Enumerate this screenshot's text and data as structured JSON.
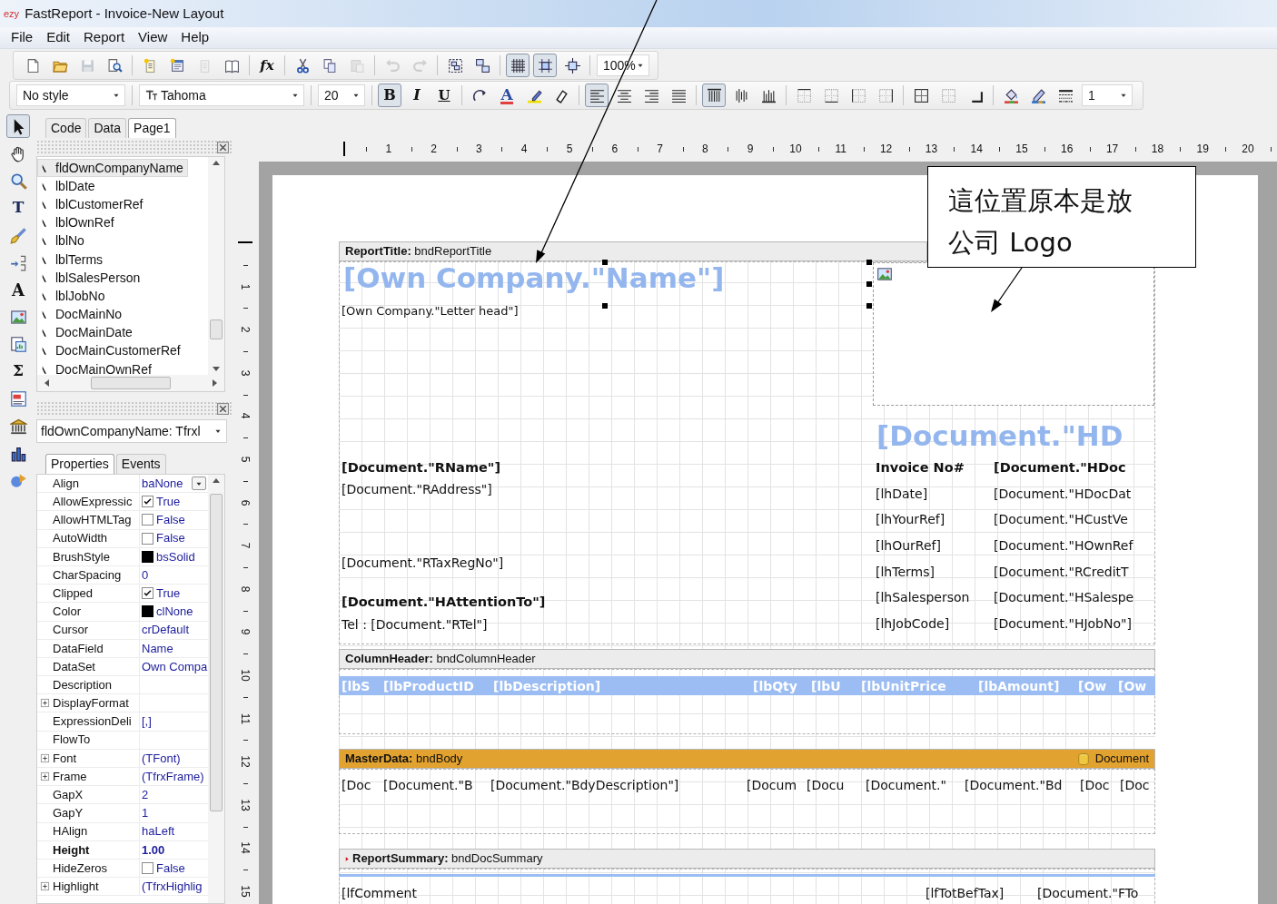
{
  "window": {
    "app_badge": "ezy",
    "title": "FastReport - Invoice-New Layout"
  },
  "menu": [
    "File",
    "Edit",
    "Report",
    "View",
    "Help"
  ],
  "toolbar_standard": [
    [
      {
        "kind": "new",
        "selected": false,
        "disabled": false
      },
      {
        "kind": "open",
        "selected": false,
        "disabled": false
      },
      {
        "kind": "save",
        "selected": false,
        "disabled": true
      },
      {
        "kind": "preview",
        "selected": false,
        "disabled": false
      }
    ],
    [
      {
        "kind": "addpage",
        "selected": false,
        "disabled": false
      },
      {
        "kind": "adddialog",
        "selected": false,
        "disabled": false
      },
      {
        "kind": "delpage",
        "selected": false,
        "disabled": true
      },
      {
        "kind": "pagesettings",
        "selected": false,
        "disabled": false
      }
    ],
    [
      {
        "kind": "formula",
        "label": "fx",
        "selected": false,
        "disabled": false
      }
    ],
    [
      {
        "kind": "cut",
        "selected": false,
        "disabled": false
      },
      {
        "kind": "copy",
        "selected": false,
        "disabled": false
      },
      {
        "kind": "paste",
        "selected": false,
        "disabled": true
      }
    ],
    [
      {
        "kind": "undo",
        "selected": false,
        "disabled": true
      },
      {
        "kind": "redo",
        "selected": false,
        "disabled": true
      }
    ],
    [
      {
        "kind": "group",
        "selected": false,
        "disabled": false
      },
      {
        "kind": "ungroup",
        "selected": false,
        "disabled": false
      }
    ],
    [
      {
        "kind": "grid",
        "selected": true,
        "disabled": false
      },
      {
        "kind": "snap",
        "selected": true,
        "disabled": false
      },
      {
        "kind": "fit",
        "selected": false,
        "disabled": false
      }
    ],
    [
      {
        "kind": "combo",
        "value": "100%"
      }
    ]
  ],
  "toolbar_format": [
    [
      {
        "kind": "combo",
        "value": "No style"
      }
    ],
    [
      {
        "kind": "font_combo",
        "value": "Tahoma"
      }
    ],
    [
      {
        "kind": "combo",
        "value": "20"
      }
    ],
    [
      {
        "kind": "bold",
        "label": "B",
        "selected": true,
        "disabled": false
      },
      {
        "kind": "italic",
        "label": "I",
        "selected": false,
        "disabled": false
      },
      {
        "kind": "underline",
        "label": "U",
        "selected": false,
        "disabled": false
      }
    ],
    [
      {
        "kind": "rotate",
        "selected": false,
        "disabled": false
      },
      {
        "kind": "fontcolor",
        "label": "A",
        "selected": false,
        "disabled": false
      },
      {
        "kind": "highlight",
        "selected": false,
        "disabled": false
      },
      {
        "kind": "clearfmt",
        "selected": false,
        "disabled": false
      }
    ],
    [
      {
        "kind": "alignleft",
        "selected": true,
        "disabled": false
      },
      {
        "kind": "aligncenter",
        "selected": false,
        "disabled": false
      },
      {
        "kind": "alignright",
        "selected": false,
        "disabled": false
      },
      {
        "kind": "justify",
        "selected": false,
        "disabled": false
      }
    ],
    [
      {
        "kind": "vtop",
        "selected": true,
        "disabled": false
      },
      {
        "kind": "vmid",
        "selected": false,
        "disabled": false
      },
      {
        "kind": "vbottom",
        "selected": false,
        "disabled": false
      }
    ],
    [
      {
        "kind": "frametop",
        "selected": false,
        "disabled": false
      },
      {
        "kind": "framebottom",
        "selected": false,
        "disabled": false
      },
      {
        "kind": "frameleft",
        "selected": false,
        "disabled": false
      },
      {
        "kind": "frameright",
        "selected": false,
        "disabled": false
      }
    ],
    [
      {
        "kind": "frameall",
        "selected": false,
        "disabled": false
      },
      {
        "kind": "framenone",
        "selected": false,
        "disabled": false
      },
      {
        "kind": "shadow",
        "selected": false,
        "disabled": false
      }
    ],
    [
      {
        "kind": "fill",
        "selected": false,
        "disabled": false
      },
      {
        "kind": "framecolor",
        "selected": false,
        "disabled": false
      },
      {
        "kind": "linestyle",
        "selected": false,
        "disabled": false
      },
      {
        "kind": "combo",
        "value": "1"
      }
    ]
  ],
  "toolbox": [
    {
      "kind": "select",
      "selected": true
    },
    {
      "kind": "hand",
      "selected": false
    },
    {
      "kind": "zoom",
      "selected": false
    },
    {
      "kind": "textedit",
      "label": "T",
      "selected": false
    },
    {
      "kind": "brush",
      "selected": false
    },
    {
      "kind": "connector",
      "selected": false
    },
    {
      "kind": "textobj",
      "label": "A",
      "selected": false
    },
    {
      "kind": "picture",
      "selected": false
    },
    {
      "kind": "subreport",
      "selected": false
    },
    {
      "kind": "sum",
      "label": "Σ",
      "selected": false
    },
    {
      "kind": "richtext",
      "selected": false
    },
    {
      "kind": "building",
      "selected": false
    },
    {
      "kind": "chart",
      "selected": false
    },
    {
      "kind": "shapes",
      "selected": false
    }
  ],
  "page_tabs": [
    {
      "label": "Code",
      "selected": false
    },
    {
      "label": "Data",
      "selected": false
    },
    {
      "label": "Page1",
      "selected": true
    }
  ],
  "object_tree": [
    {
      "label": "fldOwnCompanyName",
      "selected": true
    },
    {
      "label": "lblDate",
      "selected": false
    },
    {
      "label": "lblCustomerRef",
      "selected": false
    },
    {
      "label": "lblOwnRef",
      "selected": false
    },
    {
      "label": "lblNo",
      "selected": false
    },
    {
      "label": "lblTerms",
      "selected": false
    },
    {
      "label": "lblSalesPerson",
      "selected": false
    },
    {
      "label": "lblJobNo",
      "selected": false
    },
    {
      "label": "DocMainNo",
      "selected": false
    },
    {
      "label": "DocMainDate",
      "selected": false
    },
    {
      "label": "DocMainCustomerRef",
      "selected": false
    },
    {
      "label": "DocMainOwnRef",
      "selected": false
    }
  ],
  "object_selector": "fldOwnCompanyName: Tfrxl",
  "inspector_tabs": [
    {
      "label": "Properties",
      "selected": true
    },
    {
      "label": "Events",
      "selected": false
    }
  ],
  "properties": [
    {
      "name": "Align",
      "value": "baNone",
      "kind": "dropdown",
      "expandable": false,
      "modified": false
    },
    {
      "name": "AllowExpressic",
      "value": "True",
      "kind": "check",
      "checked": true,
      "expandable": false,
      "modified": false
    },
    {
      "name": "AllowHTMLTag",
      "value": "False",
      "kind": "check",
      "checked": false,
      "expandable": false,
      "modified": false
    },
    {
      "name": "AutoWidth",
      "value": "False",
      "kind": "check",
      "checked": false,
      "expandable": false,
      "modified": false
    },
    {
      "name": "BrushStyle",
      "value": "bsSolid",
      "kind": "swatch",
      "expandable": false,
      "modified": false
    },
    {
      "name": "CharSpacing",
      "value": "0",
      "kind": "text",
      "expandable": false,
      "modified": false
    },
    {
      "name": "Clipped",
      "value": "True",
      "kind": "check",
      "checked": true,
      "expandable": false,
      "modified": false
    },
    {
      "name": "Color",
      "value": "clNone",
      "kind": "swatch",
      "expandable": false,
      "modified": false
    },
    {
      "name": "Cursor",
      "value": "crDefault",
      "kind": "text",
      "expandable": false,
      "modified": false
    },
    {
      "name": "DataField",
      "value": "Name",
      "kind": "text",
      "expandable": false,
      "modified": false
    },
    {
      "name": "DataSet",
      "value": "Own Compa",
      "kind": "text",
      "expandable": false,
      "modified": false
    },
    {
      "name": "Description",
      "kind": "text",
      "expandable": false,
      "modified": false
    },
    {
      "name": "DisplayFormat",
      "kind": "text",
      "expandable": true,
      "modified": false
    },
    {
      "name": "ExpressionDeli",
      "value": "[,]",
      "kind": "text",
      "expandable": false,
      "modified": false
    },
    {
      "name": "FlowTo",
      "kind": "text",
      "expandable": false,
      "modified": false
    },
    {
      "name": "Font",
      "value": "(TFont)",
      "kind": "text",
      "expandable": true,
      "modified": false
    },
    {
      "name": "Frame",
      "value": "(TfrxFrame)",
      "kind": "text",
      "expandable": true,
      "modified": false
    },
    {
      "name": "GapX",
      "value": "2",
      "kind": "text",
      "expandable": false,
      "modified": false
    },
    {
      "name": "GapY",
      "value": "1",
      "kind": "text",
      "expandable": false,
      "modified": false
    },
    {
      "name": "HAlign",
      "value": "haLeft",
      "kind": "text",
      "expandable": false,
      "modified": false
    },
    {
      "name": "Height",
      "value": "1.00",
      "kind": "text",
      "expandable": false,
      "modified": true
    },
    {
      "name": "HideZeros",
      "value": "False",
      "kind": "check",
      "checked": false,
      "expandable": false,
      "modified": false
    },
    {
      "name": "Highlight",
      "value": "(TfrxHighlig",
      "kind": "text",
      "expandable": true,
      "modified": false
    }
  ],
  "ruler": {
    "horizontal": [
      "1",
      "2",
      "3",
      "4",
      "5",
      "6",
      "7",
      "8",
      "9",
      "10",
      "11",
      "12",
      "13",
      "14",
      "15",
      "16",
      "17",
      "18",
      "19",
      "20"
    ],
    "vertical": [
      "1",
      "2",
      "3",
      "4",
      "5",
      "6",
      "7",
      "8",
      "9",
      "10",
      "11",
      "12",
      "13",
      "14",
      "15"
    ]
  },
  "report": {
    "title_band": {
      "caption": "**ReportTitle:** bndReportTitle",
      "fields": [
        {
          "text": "[Own Company.\"Name\"]",
          "kind": "big"
        },
        {
          "text": "[Own Company.\"Letter head\"]",
          "kind": "small"
        },
        {
          "text": "[Document.\"HD",
          "kind": "big"
        },
        {
          "text": "[Document.\"RName\"]",
          "kind": "bold"
        },
        {
          "text": "[Document.\"RAddress\"]",
          "kind": "plain"
        },
        {
          "text": "[Document.\"RTaxRegNo\"]",
          "kind": "plain"
        },
        {
          "text": "[Document.\"HAttentionTo\"]",
          "kind": "bold"
        },
        {
          "text": "Tel : [Document.\"RTel\"]",
          "kind": "plain"
        },
        {
          "text": "Invoice No#",
          "kind": "bold"
        },
        {
          "text": "[lhDate]",
          "kind": "plain"
        },
        {
          "text": "[lhYourRef]",
          "kind": "plain"
        },
        {
          "text": "[lhOurRef]",
          "kind": "plain"
        },
        {
          "text": "[lhTerms]",
          "kind": "plain"
        },
        {
          "text": "[lhSalesperson",
          "kind": "plain"
        },
        {
          "text": "[lhJobCode]",
          "kind": "plain"
        },
        {
          "text": "[Document.\"HDoc",
          "kind": "bold"
        },
        {
          "text": "[Document.\"HDocDat",
          "kind": "plain"
        },
        {
          "text": "[Document.\"HCustVe",
          "kind": "plain"
        },
        {
          "text": "[Document.\"HOwnRef",
          "kind": "plain"
        },
        {
          "text": "[Document.\"RCreditT",
          "kind": "plain"
        },
        {
          "text": "[Document.\"HSalespe",
          "kind": "plain"
        },
        {
          "text": "[Document.\"HJobNo\"]",
          "kind": "plain"
        }
      ]
    },
    "column_header_band": {
      "caption": "**ColumnHeader:** bndColumnHeader",
      "fields": [
        {
          "text": "[lbS",
          "kind": "header"
        },
        {
          "text": "[lbProductID",
          "kind": "header"
        },
        {
          "text": "[lbDescription]",
          "kind": "header"
        },
        {
          "text": "[lbQty",
          "kind": "header"
        },
        {
          "text": "[lbU",
          "kind": "header"
        },
        {
          "text": "[lbUnitPrice",
          "kind": "header"
        },
        {
          "text": "[lbAmount]",
          "kind": "header"
        },
        {
          "text": "[Ow",
          "kind": "header"
        },
        {
          "text": "[Ow",
          "kind": "header"
        }
      ]
    },
    "master_data_band": {
      "caption": "**MasterData:** bndBody",
      "dataset": "Document",
      "fields": [
        {
          "text": "[Doc",
          "kind": "plain"
        },
        {
          "text": "[Document.\"B",
          "kind": "plain"
        },
        {
          "text": "[Document.\"BdyDescription\"]",
          "kind": "plain"
        },
        {
          "text": "[Docum",
          "kind": "plain"
        },
        {
          "text": "[Docu",
          "kind": "plain"
        },
        {
          "text": "[Document.\"",
          "kind": "plain"
        },
        {
          "text": "[Document.\"Bd",
          "kind": "plain"
        },
        {
          "text": "[Doc",
          "kind": "plain"
        },
        {
          "text": "[Doc",
          "kind": "plain"
        }
      ]
    },
    "summary_band": {
      "caption": "**ReportSummary:** bndDocSummary",
      "fields": [
        {
          "text": "[lfComment",
          "kind": "plain"
        },
        {
          "text": "[lfTotBefTax]",
          "kind": "plain"
        },
        {
          "text": "[Document.\"FTo",
          "kind": "plain"
        }
      ]
    }
  },
  "callout": {
    "lines": [
      "這位置原本是放",
      "公司 Logo"
    ]
  }
}
